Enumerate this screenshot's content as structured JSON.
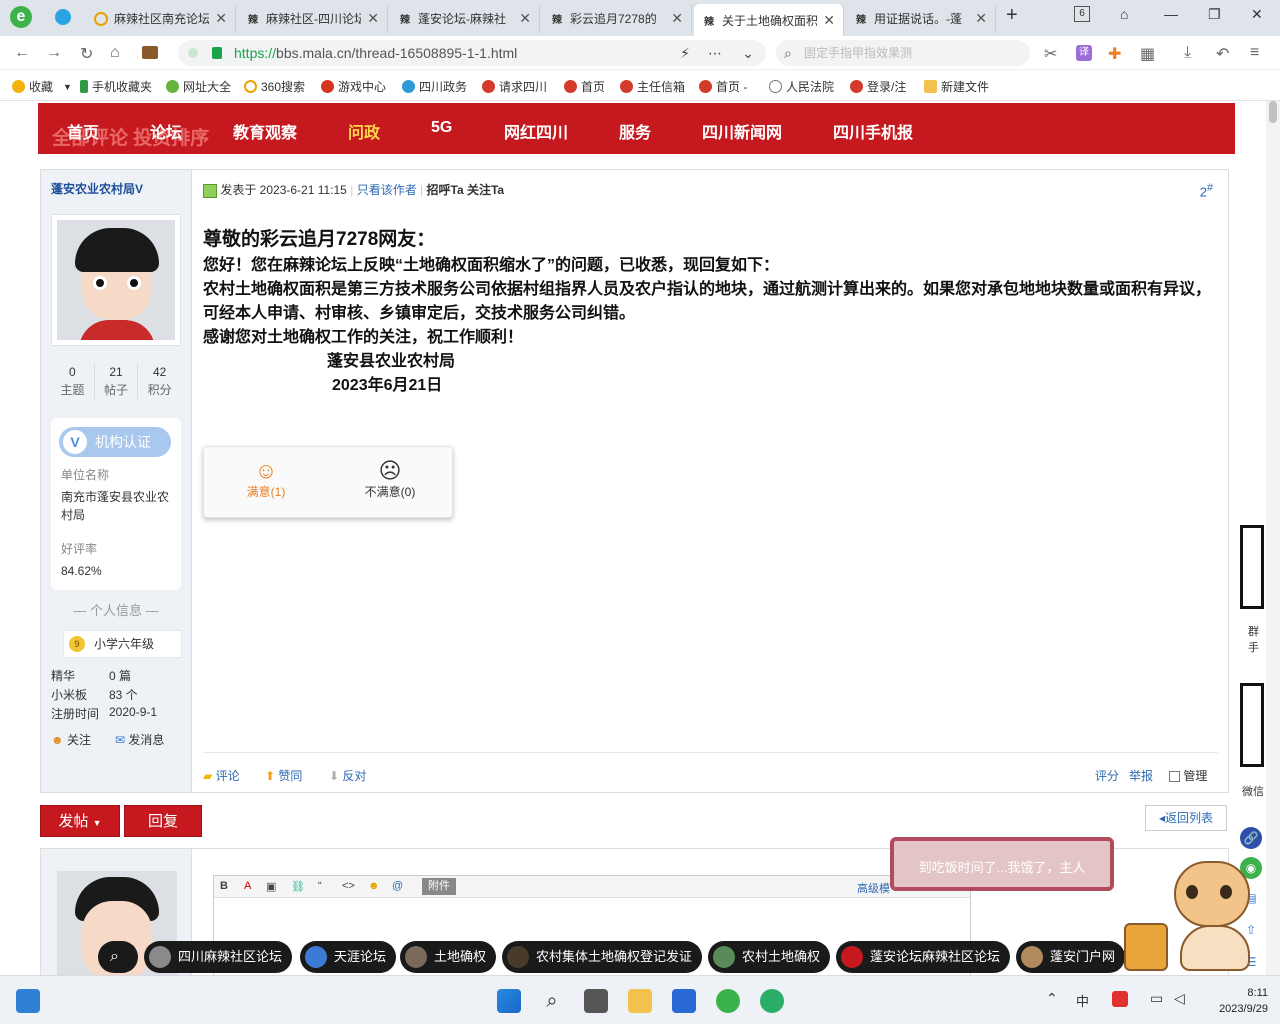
{
  "browser": {
    "tabs": [
      {
        "label": "麻辣社区南充论坛",
        "active": false
      },
      {
        "label": "麻辣社区-四川论坛",
        "active": false
      },
      {
        "label": "蓬安论坛-麻辣社",
        "active": false
      },
      {
        "label": "彩云追月7278的",
        "active": false
      },
      {
        "label": "关于土地确权面积",
        "active": true
      },
      {
        "label": "用证据说话。-蓬",
        "active": false
      }
    ],
    "tab_count": "6",
    "url_scheme": "https://",
    "url_rest": "bbs.mala.cn/thread-16508895-1-1.html",
    "search_placeholder": "固定手指甲指效果测",
    "bookmarks": [
      "收藏",
      "手机收藏夹",
      "网址大全",
      "360搜索",
      "游戏中心",
      "四川政务",
      "请求四川",
      "首页",
      "主任信箱",
      "首页 -",
      "人民法院",
      "登录/注",
      "新建文件"
    ]
  },
  "site": {
    "nav": [
      "首页",
      "论坛",
      "教育观察",
      "问政",
      "5G",
      "网红四川",
      "服务",
      "四川新闻网",
      "四川手机报"
    ],
    "nav_highlight": "问政",
    "ghost_text": "全部评论 投资排序"
  },
  "post": {
    "author": "蓬安农业农村局V",
    "stats": [
      {
        "value": "0",
        "label": "主题"
      },
      {
        "value": "21",
        "label": "帖子"
      },
      {
        "value": "42",
        "label": "积分"
      }
    ],
    "org": {
      "badge": "机构认证",
      "unit_label": "单位名称",
      "unit_value": "南充市蓬安县农业农村局",
      "rating_label": "好评率",
      "rating_value": "84.62%"
    },
    "personal_header": "个人信息",
    "grade": {
      "level": "9",
      "name": "小学六年级"
    },
    "info": [
      {
        "key": "精华",
        "value": "0 篇"
      },
      {
        "key": "小米板",
        "value": "83 个"
      },
      {
        "key": "注册时间",
        "value": "2020-9-1"
      }
    ],
    "follow": "关注",
    "send_message": "发消息",
    "meta": {
      "posted": "发表于 2023-6-21 11:15",
      "only_author": "只看该作者",
      "greet": "招呼Ta",
      "follow": "关注Ta"
    },
    "floor_num": "2",
    "floor_suffix": "#",
    "body": {
      "greeting": "尊敬的彩云追月7278网友：",
      "line1": "您好！您在麻辣论坛上反映“土地确权面积缩水了”的问题，已收悉，现回复如下：",
      "line2": "农村土地确权面积是第三方技术服务公司依据村组指界人员及农户指认的地块，通过航测计算出来的。如果您对承包地地块数量或面积有异议，可经本人申请、村审核、乡镇审定后，交技术服务公司纠错。",
      "line3": "感谢您对土地确权工作的关注，祝工作顺利！",
      "sign": "蓬安县农业农村局",
      "date": "2023年6月21日"
    },
    "rating": {
      "satisfied": "满意(1)",
      "unsatisfied": "不满意(0)"
    },
    "actions": {
      "comment": "评论",
      "upvote": "赞同",
      "oppose": "反对",
      "score": "评分",
      "report": "举报",
      "manage": "管理"
    }
  },
  "buttons": {
    "post": "发帖",
    "reply": "回复",
    "back": "返回列表"
  },
  "editor": {
    "attach": "附件",
    "advanced": "高级模"
  },
  "sidebar_labels": [
    "群",
    "手",
    "微信"
  ],
  "pet_message": "到吃饭时间了...我饿了，主人",
  "related": [
    "四川麻辣社区论坛",
    "天涯论坛",
    "土地确权",
    "农村集体土地确权登记发证",
    "农村土地确权",
    "蓬安论坛麻辣社区论坛",
    "蓬安门户网"
  ],
  "taskbar": {
    "ime": "中",
    "time": "8:11",
    "date": "2023/9/29"
  },
  "colors": {
    "brand_red": "#c6191f",
    "link_blue": "#2d6ab3",
    "nav_highlight": "#ffd84a"
  }
}
